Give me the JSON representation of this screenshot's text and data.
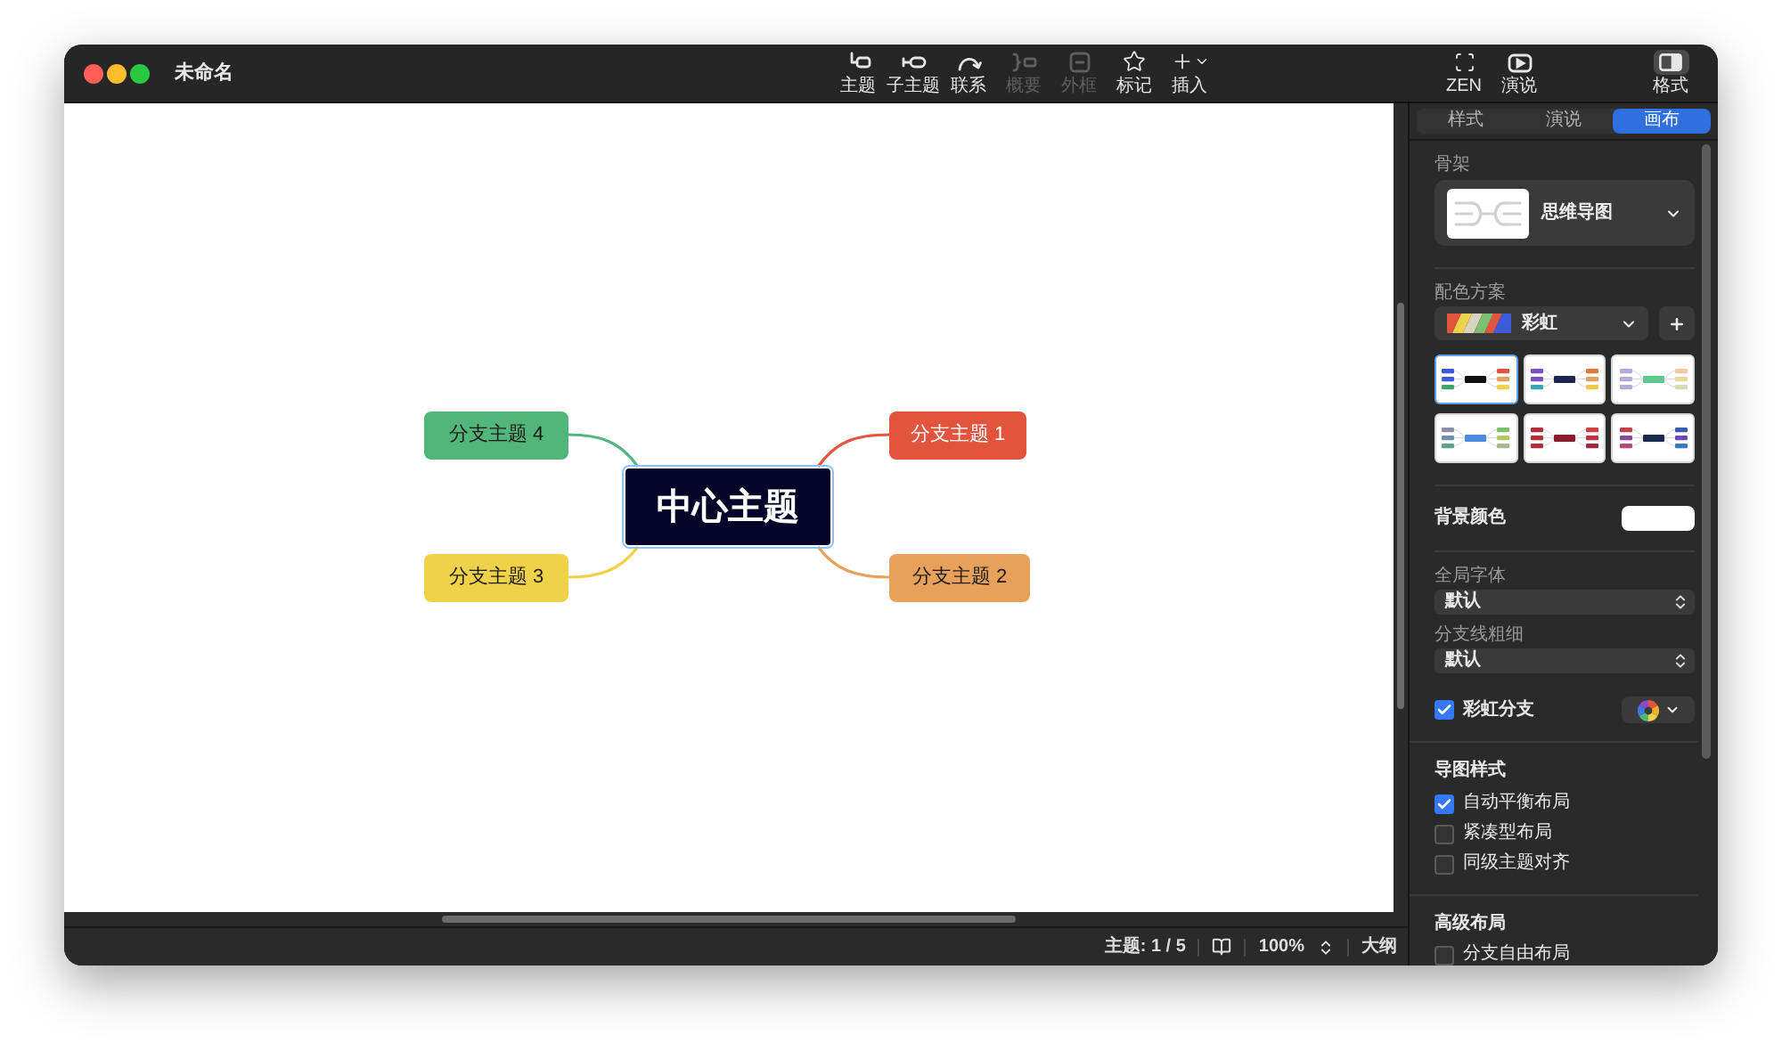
{
  "window": {
    "title": "未命名"
  },
  "toolbar": {
    "items": [
      {
        "label": "主题",
        "disabled": false
      },
      {
        "label": "子主题",
        "disabled": false
      },
      {
        "label": "联系",
        "disabled": false
      },
      {
        "label": "概要",
        "disabled": true
      },
      {
        "label": "外框",
        "disabled": true
      },
      {
        "label": "标记",
        "disabled": false
      },
      {
        "label": "插入",
        "disabled": false
      }
    ],
    "right_items": [
      {
        "label": "ZEN",
        "selected": false
      },
      {
        "label": "演说",
        "selected": false
      },
      {
        "label": "格式",
        "selected": true
      }
    ]
  },
  "canvas": {
    "central_topic": {
      "label": "中心主题",
      "selected": true
    },
    "branches": [
      {
        "label": "分支主题 4",
        "color": "#52b67a"
      },
      {
        "label": "分支主题 1",
        "color": "#e2543e"
      },
      {
        "label": "分支主题 3",
        "color": "#efd24a"
      },
      {
        "label": "分支主题 2",
        "color": "#e8a15a"
      }
    ]
  },
  "status_bar": {
    "topic_count": "主题: 1 / 5",
    "zoom": "100%",
    "outline": "大纲"
  },
  "panel": {
    "tabs": [
      {
        "label": "样式",
        "selected": false
      },
      {
        "label": "演说",
        "selected": false
      },
      {
        "label": "画布",
        "selected": true
      }
    ],
    "skeleton": {
      "label": "骨架",
      "value": "思维导图"
    },
    "color_scheme": {
      "label": "配色方案",
      "value": "彩虹",
      "themes": [
        {
          "selected": true
        },
        {
          "selected": false
        },
        {
          "selected": false
        },
        {
          "selected": false
        },
        {
          "selected": false
        },
        {
          "selected": false
        }
      ]
    },
    "background_color": {
      "label": "背景颜色",
      "color": "#ffffff"
    },
    "global_font": {
      "label": "全局字体",
      "value": "默认"
    },
    "branch_line_width": {
      "label": "分支线粗细",
      "value": "默认"
    },
    "rainbow_branches": {
      "label": "彩虹分支",
      "checked": true
    },
    "map_style": {
      "title": "导图样式",
      "options": [
        {
          "label": "自动平衡布局",
          "checked": true
        },
        {
          "label": "紧凑型布局",
          "checked": false
        },
        {
          "label": "同级主题对齐",
          "checked": false
        }
      ]
    },
    "advanced_layout": {
      "title": "高级布局",
      "options": [
        {
          "label": "分支自由布局",
          "checked": false
        }
      ]
    }
  }
}
